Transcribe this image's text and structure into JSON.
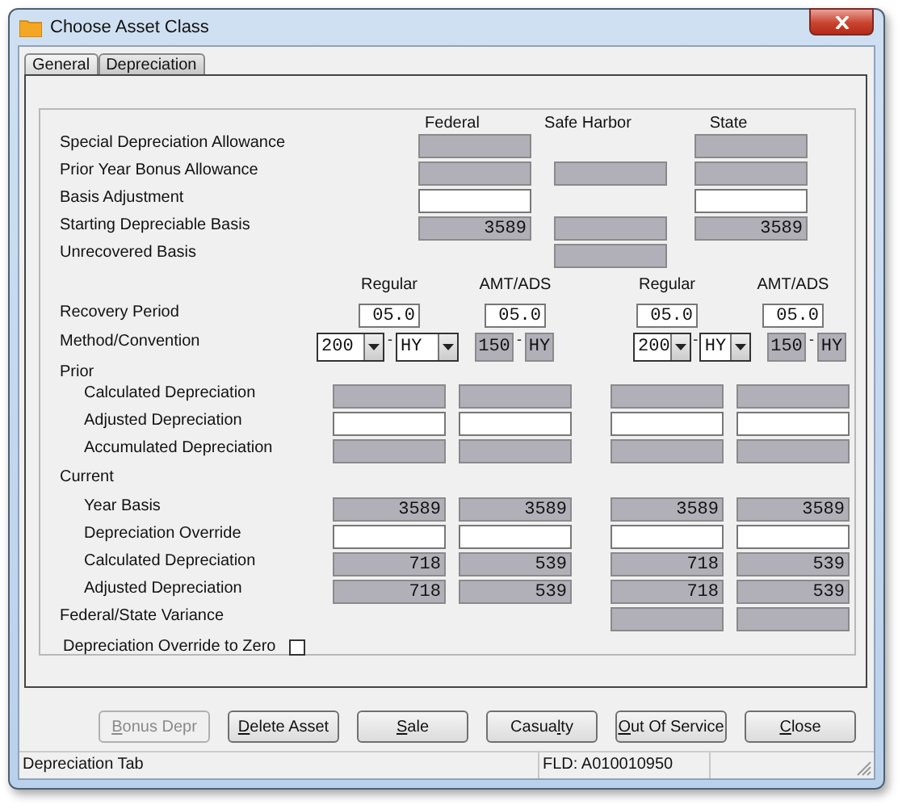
{
  "window": {
    "title": "Choose Asset Class"
  },
  "tabs": [
    {
      "label": "General",
      "selected": false
    },
    {
      "label": "Depreciation",
      "selected": true
    }
  ],
  "top": {
    "columns": [
      "Federal",
      "Safe Harbor",
      "State"
    ],
    "rows": [
      {
        "label": "Special Depreciation Allowance",
        "cells": [
          {
            "kind": "readonly"
          },
          {
            "kind": "none"
          },
          {
            "kind": "readonly"
          }
        ]
      },
      {
        "label": "Prior Year Bonus Allowance",
        "cells": [
          {
            "kind": "readonly"
          },
          {
            "kind": "readonly"
          },
          {
            "kind": "readonly"
          }
        ]
      },
      {
        "label": "Basis Adjustment",
        "cells": [
          {
            "kind": "input"
          },
          {
            "kind": "none"
          },
          {
            "kind": "input"
          }
        ]
      },
      {
        "label": "Starting Depreciable Basis",
        "cells": [
          {
            "kind": "readonly",
            "value": "3589"
          },
          {
            "kind": "readonly"
          },
          {
            "kind": "readonly",
            "value": "3589"
          }
        ]
      },
      {
        "label": "Unrecovered Basis",
        "cells": [
          {
            "kind": "none"
          },
          {
            "kind": "readonly"
          },
          {
            "kind": "none"
          }
        ]
      }
    ]
  },
  "bottom": {
    "columns": [
      "Regular",
      "AMT/ADS",
      "Regular",
      "AMT/ADS"
    ],
    "recovery": {
      "label": "Recovery Period",
      "values": [
        "05.0",
        "05.0",
        "05.0",
        "05.0"
      ]
    },
    "method": {
      "label": "Method/Convention",
      "groups": [
        {
          "method": "200",
          "separator": "-",
          "convention": "HY",
          "editable": true
        },
        {
          "method": "150",
          "separator": "-",
          "convention": "HY",
          "editable": false
        },
        {
          "method": "200",
          "separator": "-",
          "convention": "HY",
          "editable": true
        },
        {
          "method": "150",
          "separator": "-",
          "convention": "HY",
          "editable": false
        }
      ]
    },
    "sections": [
      {
        "label": "Prior",
        "rows": [
          {
            "label": "Calculated Depreciation",
            "cells": [
              {
                "kind": "readonly"
              },
              {
                "kind": "readonly"
              },
              {
                "kind": "readonly"
              },
              {
                "kind": "readonly"
              }
            ]
          },
          {
            "label": "Adjusted Depreciation",
            "cells": [
              {
                "kind": "input"
              },
              {
                "kind": "input"
              },
              {
                "kind": "input"
              },
              {
                "kind": "input"
              }
            ]
          },
          {
            "label": "Accumulated Depreciation",
            "cells": [
              {
                "kind": "readonly"
              },
              {
                "kind": "readonly"
              },
              {
                "kind": "readonly"
              },
              {
                "kind": "readonly"
              }
            ]
          }
        ]
      },
      {
        "label": "Current",
        "rows": [
          {
            "label": "Year Basis",
            "cells": [
              {
                "kind": "readonly",
                "value": "3589"
              },
              {
                "kind": "readonly",
                "value": "3589"
              },
              {
                "kind": "readonly",
                "value": "3589"
              },
              {
                "kind": "readonly",
                "value": "3589"
              }
            ]
          },
          {
            "label": "Depreciation Override",
            "cells": [
              {
                "kind": "input"
              },
              {
                "kind": "input"
              },
              {
                "kind": "input"
              },
              {
                "kind": "input"
              }
            ]
          },
          {
            "label": "Calculated Depreciation",
            "cells": [
              {
                "kind": "readonly",
                "value": "718"
              },
              {
                "kind": "readonly",
                "value": "539"
              },
              {
                "kind": "readonly",
                "value": "718"
              },
              {
                "kind": "readonly",
                "value": "539"
              }
            ]
          },
          {
            "label": "Adjusted Depreciation",
            "cells": [
              {
                "kind": "readonly",
                "value": "718"
              },
              {
                "kind": "readonly",
                "value": "539"
              },
              {
                "kind": "readonly",
                "value": "718"
              },
              {
                "kind": "readonly",
                "value": "539"
              }
            ]
          }
        ]
      }
    ],
    "variance": {
      "label": "Federal/State Variance",
      "cells": [
        {
          "kind": "none"
        },
        {
          "kind": "none"
        },
        {
          "kind": "readonly"
        },
        {
          "kind": "readonly"
        }
      ]
    },
    "override_zero": {
      "label": "Depreciation Override to Zero",
      "checked": false
    }
  },
  "buttons": [
    {
      "key": "B",
      "after": "onus Depr",
      "disabled": true
    },
    {
      "key": "D",
      "after": "elete Asset",
      "disabled": false
    },
    {
      "key": "S",
      "after": "ale",
      "disabled": false
    },
    {
      "before": "Casua",
      "key": "l",
      "after": "ty",
      "disabled": false
    },
    {
      "key": "O",
      "after": "ut Of Service",
      "disabled": false
    },
    {
      "key": "C",
      "after": "lose",
      "disabled": false
    }
  ],
  "status_bar": [
    "Depreciation Tab",
    "FLD: A010010950"
  ]
}
